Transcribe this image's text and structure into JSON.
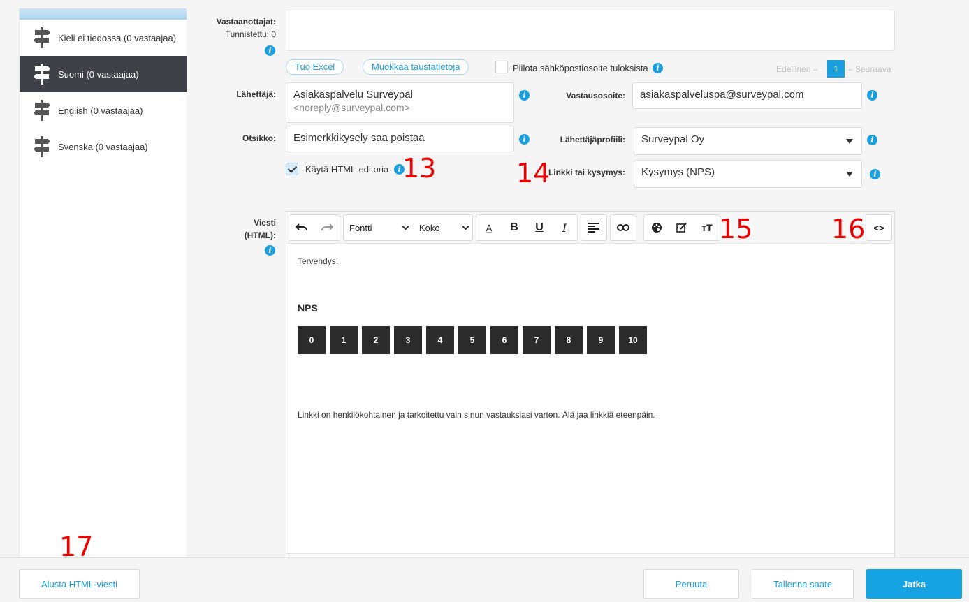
{
  "sidebar": {
    "items": [
      {
        "label": "Kieli ei tiedossa (0 vastaajaa)"
      },
      {
        "label": "Suomi (0 vastaajaa)"
      },
      {
        "label": "English (0 vastaajaa)"
      },
      {
        "label": "Svenska (0 vastaajaa)"
      }
    ]
  },
  "recipients": {
    "label": "Vastaanottajat:",
    "identified": "Tunnistettu: 0"
  },
  "actions": {
    "import_excel": "Tuo Excel",
    "edit_background": "Muokkaa taustatietoja",
    "hide_email": "Piilota sähköpostiosoite tuloksista"
  },
  "pager": {
    "prev": "Edellinen –",
    "page": "1",
    "next": "– Seuraava"
  },
  "sender": {
    "label": "Lähettäjä:",
    "name": "Asiakaspalvelu Surveypal",
    "email": "<noreply@surveypal.com>"
  },
  "reply": {
    "label": "Vastausosoite:",
    "value": "asiakaspalveluspa@surveypal.com"
  },
  "subject": {
    "label": "Otsikko:",
    "value": "Esimerkkikysely saa poistaa"
  },
  "sender_profile": {
    "label": "Lähettäjäprofiili:",
    "value": "Surveypal Oy"
  },
  "html_editor": {
    "label": "Käytä HTML-editoria",
    "checked": true
  },
  "link_question": {
    "label": "Linkki tai kysymys:",
    "value": "Kysymys (NPS)"
  },
  "message": {
    "label1": "Viesti",
    "label2": "(HTML):"
  },
  "toolbar": {
    "font": "Fontti",
    "size": "Koko"
  },
  "editor": {
    "greeting": "Tervehdys!",
    "nps_title": "NPS",
    "nps_values": [
      "0",
      "1",
      "2",
      "3",
      "4",
      "5",
      "6",
      "7",
      "8",
      "9",
      "10"
    ],
    "footer": "Linkki on henkilökohtainen ja tarkoitettu vain sinun vastauksiasi varten. Älä jaa linkkiä eteenpäin."
  },
  "annotations": {
    "n13": "13",
    "n14": "14",
    "n15": "15",
    "n16": "16",
    "n17": "17"
  },
  "buttons": {
    "reset": "Alusta HTML-viesti",
    "cancel": "Peruuta",
    "save": "Tallenna saate",
    "continue": "Jatka"
  },
  "colors": {
    "accent": "#1a9fe0",
    "sidebar_active": "#3e4147",
    "annotation": "#e00000"
  }
}
